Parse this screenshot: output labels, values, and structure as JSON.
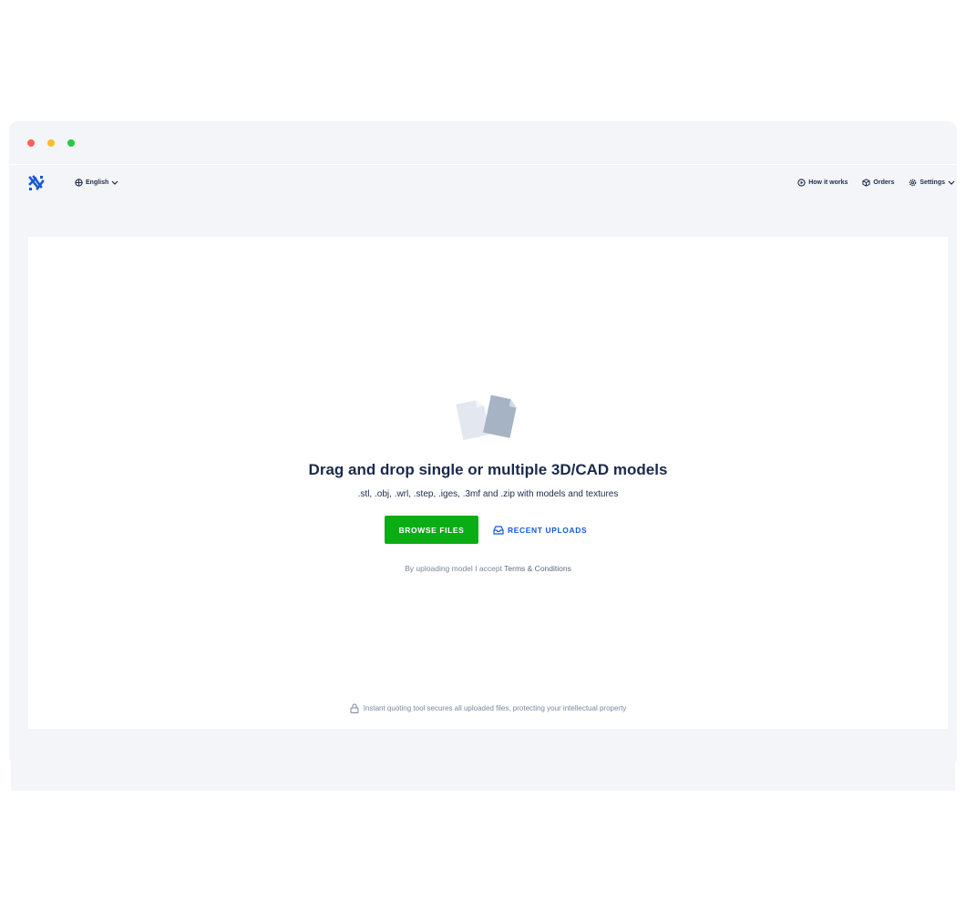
{
  "window": {
    "controls": {
      "close": "#fe5f57",
      "minimize": "#febc2e",
      "maximize": "#28c840"
    }
  },
  "header": {
    "language": "English",
    "nav": [
      {
        "label": "How it works",
        "icon": "play-circle-icon"
      },
      {
        "label": "Orders",
        "icon": "box-icon"
      },
      {
        "label": "Settings",
        "icon": "gear-icon"
      }
    ]
  },
  "upload": {
    "title": "Drag and drop single or multiple 3D/CAD models",
    "formats": ".stl, .obj, .wrl, .step, .iges, .3mf and .zip with models and textures",
    "browse_label": "BROWSE FILES",
    "recent_label": "RECENT UPLOADS",
    "terms_prefix": "By uploading model I accept",
    "terms_link": "Terms & Conditions",
    "security_note": "Instant quoting tool secures all uploaded files, protecting your intellectual property"
  },
  "colors": {
    "accent": "#1658d8",
    "primary_button": "#0bad14",
    "text": "#1b2a4a"
  }
}
